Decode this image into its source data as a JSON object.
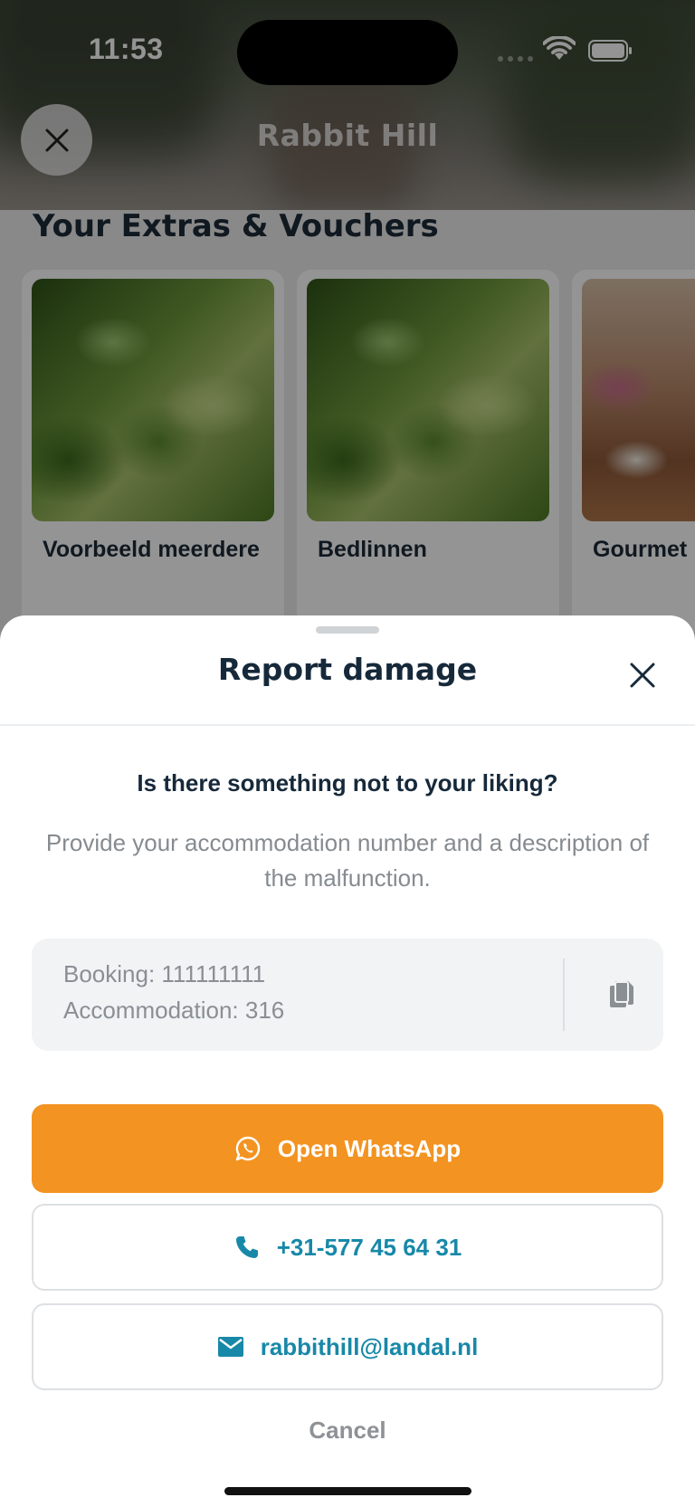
{
  "status_bar": {
    "time": "11:53"
  },
  "header": {
    "title": "Rabbit Hill",
    "close_icon": "close-icon"
  },
  "extras": {
    "section_title": "Your Extras & Vouchers",
    "cards": [
      {
        "label": "Voorbeeld meerdere",
        "image": "leaves"
      },
      {
        "label": "Bedlinnen",
        "image": "leaves"
      },
      {
        "label": "Gourmet",
        "image": "dinner-table"
      }
    ]
  },
  "sheet": {
    "title": "Report damage",
    "question": "Is there something not to your liking?",
    "description": "Provide your accommodation number and a description of the malfunction.",
    "info": {
      "booking": "Booking: 111111111",
      "accommodation": "Accommodation: 316",
      "copy_icon": "copy-icon"
    },
    "whatsapp_label": "Open WhatsApp",
    "phone_label": "+31-577 45 64 31",
    "email_label": "rabbithill@landal.nl",
    "cancel_label": "Cancel"
  },
  "colors": {
    "accent_orange": "#f39321",
    "link_teal": "#1888a8",
    "title_navy": "#16293a"
  }
}
